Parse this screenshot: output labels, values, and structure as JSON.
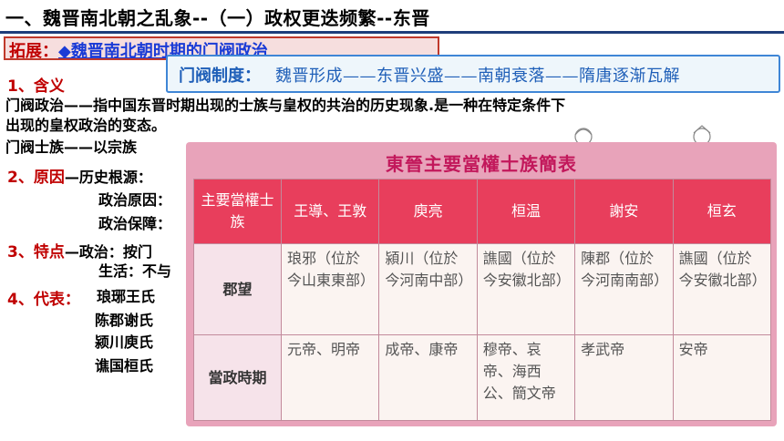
{
  "header": {
    "title": "一、魏晋南北朝之乱象--（一）政权更迭频繁--东晋"
  },
  "extension": {
    "label": "拓展：",
    "text": "◆魏晋南北朝时期的门阀政治"
  },
  "banner": {
    "label": "门阀制度：",
    "text": "魏晋形成——东晋兴盛——南朝衰落——隋唐逐渐瓦解"
  },
  "sections": {
    "meaning": {
      "heading": "1、含义",
      "line1": "门阀政治——指中国东晋时期出现的士族与皇权的共治的历史现象.是一种在特定条件下",
      "line2": "出现的皇权政治的变态。",
      "line3": "门阀士族——以宗族"
    },
    "cause": {
      "heading": "2、原因",
      "root": "—历史根源：",
      "political": "政治原因：",
      "guarantee": "政治保障："
    },
    "features": {
      "heading": "3、特点",
      "political": "—政治：按门",
      "life": "生活：不与"
    },
    "representatives": {
      "heading": "4、代表：",
      "items": [
        "琅琊王氏",
        "陈郡谢氏",
        "颍川庾氏",
        "谯国桓氏"
      ]
    }
  },
  "table": {
    "title": "東晉主要當權士族簡表",
    "header": [
      "主要當權士族",
      "王導、王敦",
      "庾亮",
      "桓温",
      "謝安",
      "桓玄"
    ],
    "rows": [
      {
        "label": "郡望",
        "cells": [
          "琅邪（位於今山東東部）",
          "潁川（位於今河南中部）",
          "譙國（位於今安徽北部）",
          "陳郡（位於今河南南部）",
          "譙國（位於今安徽北部）"
        ]
      },
      {
        "label": "當政時期",
        "cells": [
          "元帝、明帝",
          "成帝、康帝",
          "穆帝、哀帝、海西公、簡文帝",
          "孝武帝",
          "安帝"
        ]
      }
    ]
  },
  "colors": {
    "title_rule": "#1f3e7a",
    "accent_red": "#c00000",
    "link_blue": "#1a3bd6",
    "banner_border": "#3f86d6",
    "table_header": "#e83e5c",
    "table_title": "#c2185b"
  }
}
